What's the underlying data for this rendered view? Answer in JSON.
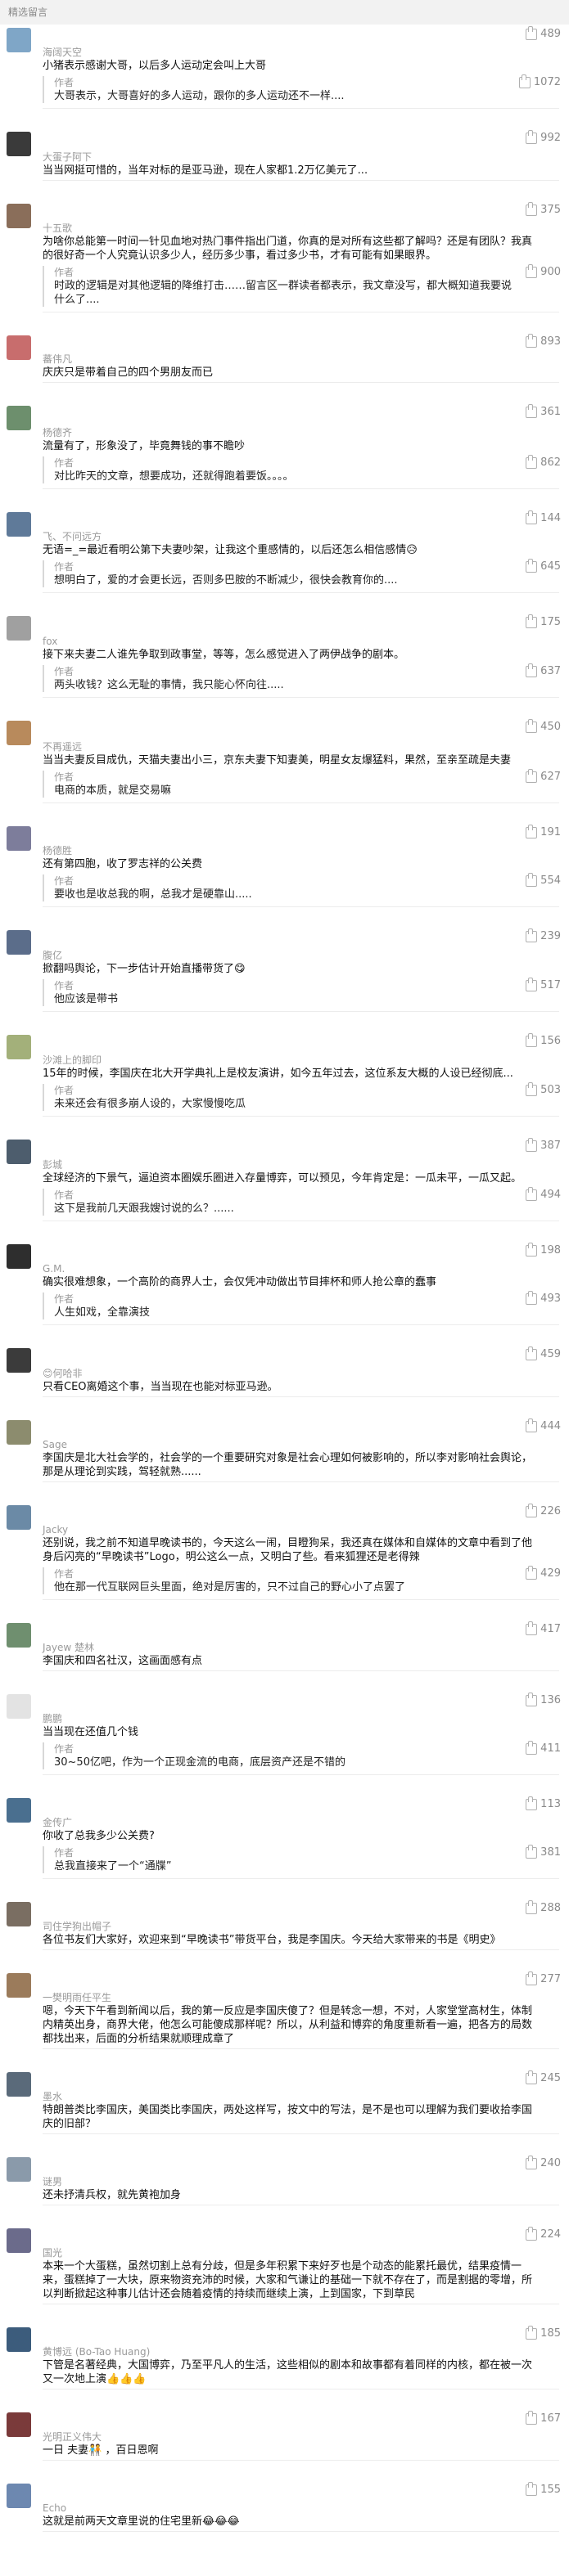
{
  "header": {
    "title": "精选留言"
  },
  "comments": [
    {
      "name": "海阔天空",
      "text": "小猪表示感谢大哥，以后多人运动定会叫上大哥",
      "likes": "489",
      "avatar_color": "#7fa6c7",
      "reply": {
        "name": "作者",
        "text": "大哥表示，大哥喜好的多人运动，跟你的多人运动还不一样....",
        "likes": "1072"
      }
    },
    {
      "name": "大蛋子阿下",
      "text": "当当网挺可惜的，当年对标的是亚马逊，现在人家都1.2万亿美元了...",
      "likes": "992",
      "avatar_color": "#3a3a3a"
    },
    {
      "name": "十五歌",
      "text": "为啥你总能第一时间一针见血地对热门事件指出门道，你真的是对所有这些都了解吗？还是有团队？我真的很好奇一个人究竟认识多少人，经历多少事，看过多少书，才有可能有如果眼界。",
      "likes": "375",
      "avatar_color": "#8a6e5a",
      "reply": {
        "name": "作者",
        "text": "时政的逻辑是对其他逻辑的降维打击……留言区一群读者都表示，我文章没写，都大概知道我要说什么了....",
        "likes": "900"
      }
    },
    {
      "name": "蕃伟凡",
      "text": "庆庆只是带着自己的四个男朋友而已",
      "likes": "893",
      "avatar_color": "#c86d6d"
    },
    {
      "name": "杨德齐",
      "text": "流量有了，形象没了，毕竟舞钱的事不瞻吵",
      "likes": "361",
      "avatar_color": "#6d8f6d",
      "reply": {
        "name": "作者",
        "text": "对比昨天的文章，想要成功，还就得跑着要饭。。。。",
        "likes": "862"
      }
    },
    {
      "name": "飞、不问远方",
      "text": "无语=_=最近看明公第下夫妻吵架，让我这个重感情的，以后还怎么相信感情😥",
      "likes": "144",
      "avatar_color": "#5f7a99",
      "reply": {
        "name": "作者",
        "text": "想明白了，爱的才会更长远，否则多巴胺的不断减少，很快会教育你的....",
        "likes": "645"
      }
    },
    {
      "name": "fox",
      "text": "接下来夫妻二人谁先争取到政事堂，等等，怎么感觉进入了两伊战争的剧本。",
      "likes": "175",
      "avatar_color": "#a0a0a0",
      "reply": {
        "name": "作者",
        "text": "两头收钱？这么无耻的事情，我只能心怀向往.....",
        "likes": "637"
      }
    },
    {
      "name": "不再遥远",
      "text": "当当夫妻反目成仇，天猫夫妻出小三，京东夫妻下知妻美，明星女友爆猛料，果然，至亲至疏是夫妻",
      "likes": "450",
      "avatar_color": "#b88a5c",
      "reply": {
        "name": "作者",
        "text": "电商的本质，就是交易嘛",
        "likes": "627"
      }
    },
    {
      "name": "杨德胜",
      "text": "还有第四胞，收了罗志祥的公关费",
      "likes": "191",
      "avatar_color": "#7d7d9b",
      "reply": {
        "name": "作者",
        "text": "要收也是收总我的啊，总我才是硬靠山.....",
        "likes": "554"
      }
    },
    {
      "name": "腹亿",
      "text": "掀翻吗舆论，下一步估计开始直播带货了😋",
      "likes": "239",
      "avatar_color": "#5b6d8a",
      "reply": {
        "name": "作者",
        "text": "他应该是带书",
        "likes": "517"
      }
    },
    {
      "name": "沙滩上的脚印",
      "text": "15年的时候，李国庆在北大开学典礼上是校友演讲，如今五年过去，这位系友大概的人设已经彻底...",
      "likes": "156",
      "avatar_color": "#a3b07a",
      "reply": {
        "name": "作者",
        "text": "未来还会有很多崩人设的，大家慢慢吃瓜",
        "likes": "503"
      }
    },
    {
      "name": "彭城",
      "text": "全球经济的下景气，逼迫资本圈娱乐圈进入存量博弈，可以预见，今年肯定是：一瓜未平，一瓜又起。",
      "likes": "387",
      "avatar_color": "#4d5d6d",
      "reply": {
        "name": "作者",
        "text": "这下是我前几天跟我嫂讨说的么？......",
        "likes": "494"
      }
    },
    {
      "name": "G.M.",
      "text": "确实很难想象，一个高阶的商界人士，会仅凭冲动做出节目摔杯和师人抢公章的蠢事",
      "likes": "198",
      "avatar_color": "#2e2e2e",
      "reply": {
        "name": "作者",
        "text": "人生如戏，全靠演技",
        "likes": "493"
      }
    },
    {
      "name": "😊何哈非",
      "text": "只看CEO离婚这个事，当当现在也能对标亚马逊。",
      "likes": "459",
      "avatar_color": "#3b3b3b"
    },
    {
      "name": "Sage",
      "text": "李国庆是北大社会学的，社会学的一个重要研究对象是社会心理如何被影响的，所以李对影响社会舆论，那是从理论到实践，驾轻就熟......",
      "likes": "444",
      "avatar_color": "#8c8c6e"
    },
    {
      "name": "Jacky",
      "text": "还别说，我之前不知道早晚读书的，今天这么一闹，目瞪狗呆，我还真在媒体和自媒体的文章中看到了他身后闪亮的“早晚读书”Logo，明公这么一点，又明白了些。看来狐狸还是老得辣",
      "likes": "226",
      "avatar_color": "#6b8aa6",
      "reply": {
        "name": "作者",
        "text": "他在那一代互联网巨头里面，绝对是厉害的，只不过自己的野心小了点罢了",
        "likes": "429"
      }
    },
    {
      "name": "Jayew 楚林",
      "text": "李国庆和四名社汉，这画面感有点",
      "likes": "417",
      "avatar_color": "#6f8f6f"
    },
    {
      "name": "鹏鹏",
      "text": "当当现在还值几个钱",
      "likes": "136",
      "avatar_color": "#e3e3e3",
      "reply": {
        "name": "作者",
        "text": "30~50亿吧，作为一个正现金流的电商，底层资产还是不错的",
        "likes": "411"
      }
    },
    {
      "name": "金传广",
      "text": "你收了总我多少公关费?",
      "likes": "113",
      "avatar_color": "#4a6f8f",
      "reply": {
        "name": "作者",
        "text": "总我直接来了一个“通牒”",
        "likes": "381"
      }
    },
    {
      "name": "司住学狗出帽子",
      "text": "各位书友们大家好，欢迎来到“早晚读书”带货平台，我是李国庆。今天给大家带来的书是《明史》",
      "likes": "288",
      "avatar_color": "#7a6e62"
    },
    {
      "name": "一樊明雨任平生",
      "text": "嗯，今天下午看到新闻以后，我的第一反应是李国庆傻了？但是转念一想，不对，人家堂堂高材生，体制内精英出身，商界大佬，他怎么可能傻成那样呢？所以，从利益和博弈的角度重新看一遍，把各方的局数都找出来，后面的分析结果就顺理成章了",
      "likes": "277",
      "avatar_color": "#9b7b5b"
    },
    {
      "name": "墨水",
      "text": "特朗普类比李国庆，美国类比李国庆，两处这样写，按文中的写法，是不是也可以理解为我们要收拾李国庆的旧部？",
      "likes": "245",
      "avatar_color": "#5a6a7a"
    },
    {
      "name": "谜男",
      "text": "还未抒清兵权，就先黄袍加身",
      "likes": "240",
      "avatar_color": "#8a9aaa"
    },
    {
      "name": "国光",
      "text": "本来一个大蛋糕，虽然切割上总有分歧，但是多年积累下来好歹也是个动态的能累托最优，结果疫情一来，蛋糕掉了一大块，原来物资充沛的时候，大家和气谦让的基础一下就不存在了，而是割据的零增，所以判断掀起这种事儿估计还会随着疫情的持续而继续上演，上到国家，下到草民",
      "likes": "224",
      "avatar_color": "#6b6b8b"
    },
    {
      "name": "黄博远 (Bo-Tao Huang)",
      "text": "下管是名著经典，大国博弈，乃至平凡人的生活，这些相似的剧本和故事都有着同样的内核，都在被一次又一次地上演👍👍👍",
      "likes": "185",
      "avatar_color": "#3c5c7c"
    },
    {
      "name": "光明正义伟大",
      "text": "一日 夫妻🧑‍🤝‍🧑 ，百日恩啊",
      "likes": "167",
      "avatar_color": "#7a3a3a"
    },
    {
      "name": "Echo",
      "text": "这就是前两天文章里说的住宅里新😂😂😂",
      "likes": "155",
      "avatar_color": "#6d88b0"
    }
  ]
}
